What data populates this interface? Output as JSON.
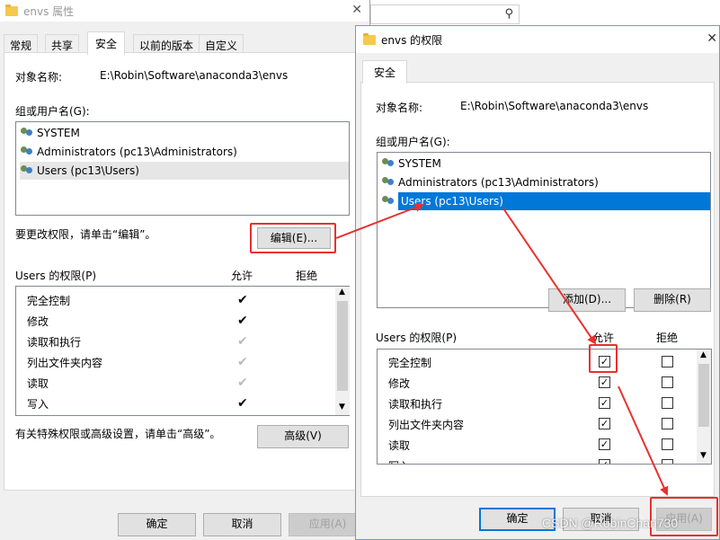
{
  "bg_window": {
    "title": "envs 属性",
    "close_glyph": "✕",
    "tabs": [
      "常规",
      "共享",
      "安全",
      "以前的版本",
      "自定义"
    ],
    "active_tab": "安全",
    "object_label": "对象名称:",
    "object_value": "E:\\Robin\\Software\\anaconda3\\envs",
    "group_label": "组或用户名(G):",
    "users": [
      "SYSTEM",
      "Administrators (pc13\\Administrators)",
      "Users (pc13\\Users)"
    ],
    "change_hint": "要更改权限，请单击“编辑”。",
    "edit_button": "编辑(E)...",
    "perm_header": "Users 的权限(P)",
    "allow_header": "允许",
    "deny_header": "拒绝",
    "permissions": [
      "完全控制",
      "修改",
      "读取和执行",
      "列出文件夹内容",
      "读取",
      "写入"
    ],
    "advanced_hint": "有关特殊权限或高级设置，请单击“高级”。",
    "advanced_button": "高级(V)",
    "ok_button": "确定",
    "cancel_button": "取消",
    "apply_button": "应用(A)"
  },
  "fg_window": {
    "title": "envs 的权限",
    "close_glyph": "✕",
    "tab": "安全",
    "object_label": "对象名称:",
    "object_value": "E:\\Robin\\Software\\anaconda3\\envs",
    "group_label": "组或用户名(G):",
    "users": [
      "SYSTEM",
      "Administrators (pc13\\Administrators)",
      "Users (pc13\\Users)"
    ],
    "add_button": "添加(D)...",
    "remove_button": "删除(R)",
    "perm_header": "Users 的权限(P)",
    "allow_header": "允许",
    "deny_header": "拒绝",
    "permissions": [
      "完全控制",
      "修改",
      "读取和执行",
      "列出文件夹内容",
      "读取",
      "写入"
    ],
    "ok_button": "确定",
    "cancel_button": "取消",
    "apply_button": "应用(A)"
  },
  "search_icon": "search-icon",
  "watermark": "CSDN @RobinChan730",
  "colors": {
    "accent": "#0078d7",
    "annotation": "#e8312f"
  }
}
